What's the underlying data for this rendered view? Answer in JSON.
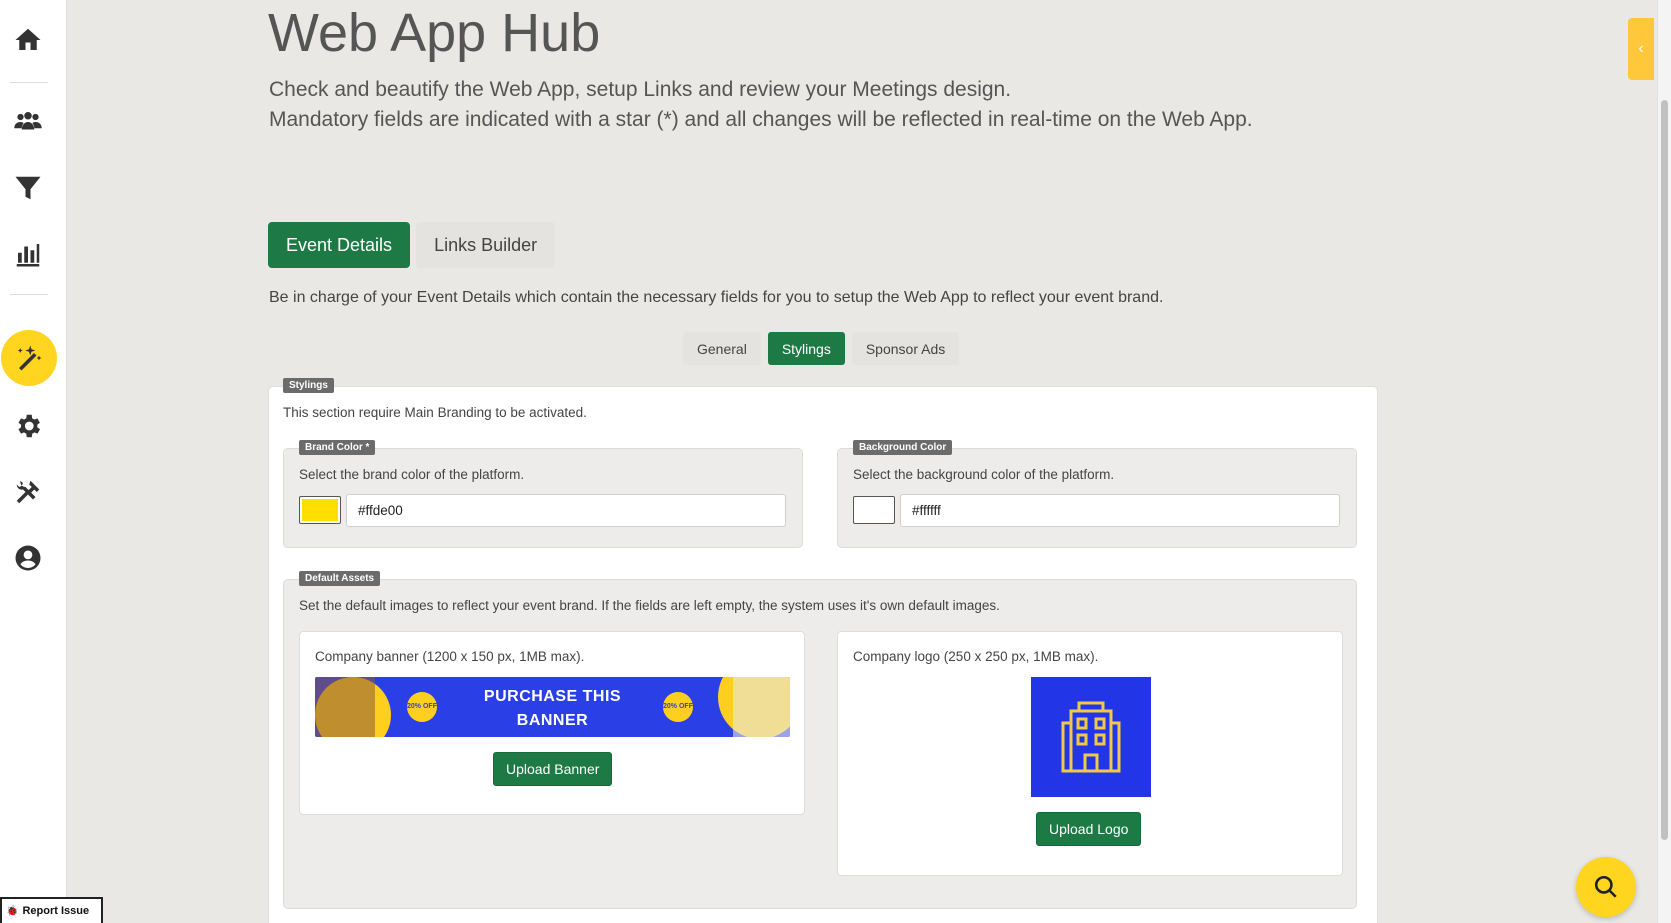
{
  "header": {
    "title": "Web App Hub",
    "subtitle_line1": "Check and beautify the Web App, setup Links and review your Meetings design.",
    "subtitle_line2": "Mandatory fields are indicated with a star (*) and all changes will be reflected in real-time on the Web App."
  },
  "sidebar": {
    "items": [
      {
        "icon": "home-icon"
      },
      {
        "icon": "users-icon"
      },
      {
        "icon": "filter-icon"
      },
      {
        "icon": "bar-chart-icon"
      },
      {
        "icon": "magic-wand-icon",
        "active": true
      },
      {
        "icon": "gear-icon"
      },
      {
        "icon": "tools-icon"
      },
      {
        "icon": "user-circle-icon"
      }
    ]
  },
  "main_tabs": [
    {
      "label": "Event Details",
      "active": true
    },
    {
      "label": "Links Builder",
      "active": false
    }
  ],
  "tab_description": "Be in charge of your Event Details which contain the necessary fields for you to setup the Web App to reflect your event brand.",
  "sub_tabs": [
    {
      "label": "General",
      "active": false
    },
    {
      "label": "Stylings",
      "active": true
    },
    {
      "label": "Sponsor Ads",
      "active": false
    }
  ],
  "stylings": {
    "tag": "Stylings",
    "note": "This section require Main Branding to be activated.",
    "brand_color": {
      "tag": "Brand Color *",
      "description": "Select the brand color of the platform.",
      "value": "#ffde00",
      "swatch": "#ffde00"
    },
    "background_color": {
      "tag": "Background Color",
      "description": "Select the background color of the platform.",
      "value": "#ffffff",
      "swatch": "#ffffff"
    },
    "default_assets": {
      "tag": "Default Assets",
      "description": "Set the default images to reflect your event brand. If the fields are left empty, the system uses it's own default images.",
      "banner": {
        "label": "Company banner (1200 x 150 px, 1MB max).",
        "image_text_line1": "PURCHASE THIS",
        "image_text_line2": "BANNER",
        "badge_text": "20% OFF",
        "button": "Upload Banner"
      },
      "logo": {
        "label": "Company logo (250 x 250 px, 1MB max).",
        "button": "Upload Logo"
      }
    }
  },
  "report_issue": "Report Issue",
  "colors": {
    "accent_green": "#1d7a45",
    "accent_yellow": "#ffd51f",
    "banner_blue": "#2a3fe6"
  }
}
